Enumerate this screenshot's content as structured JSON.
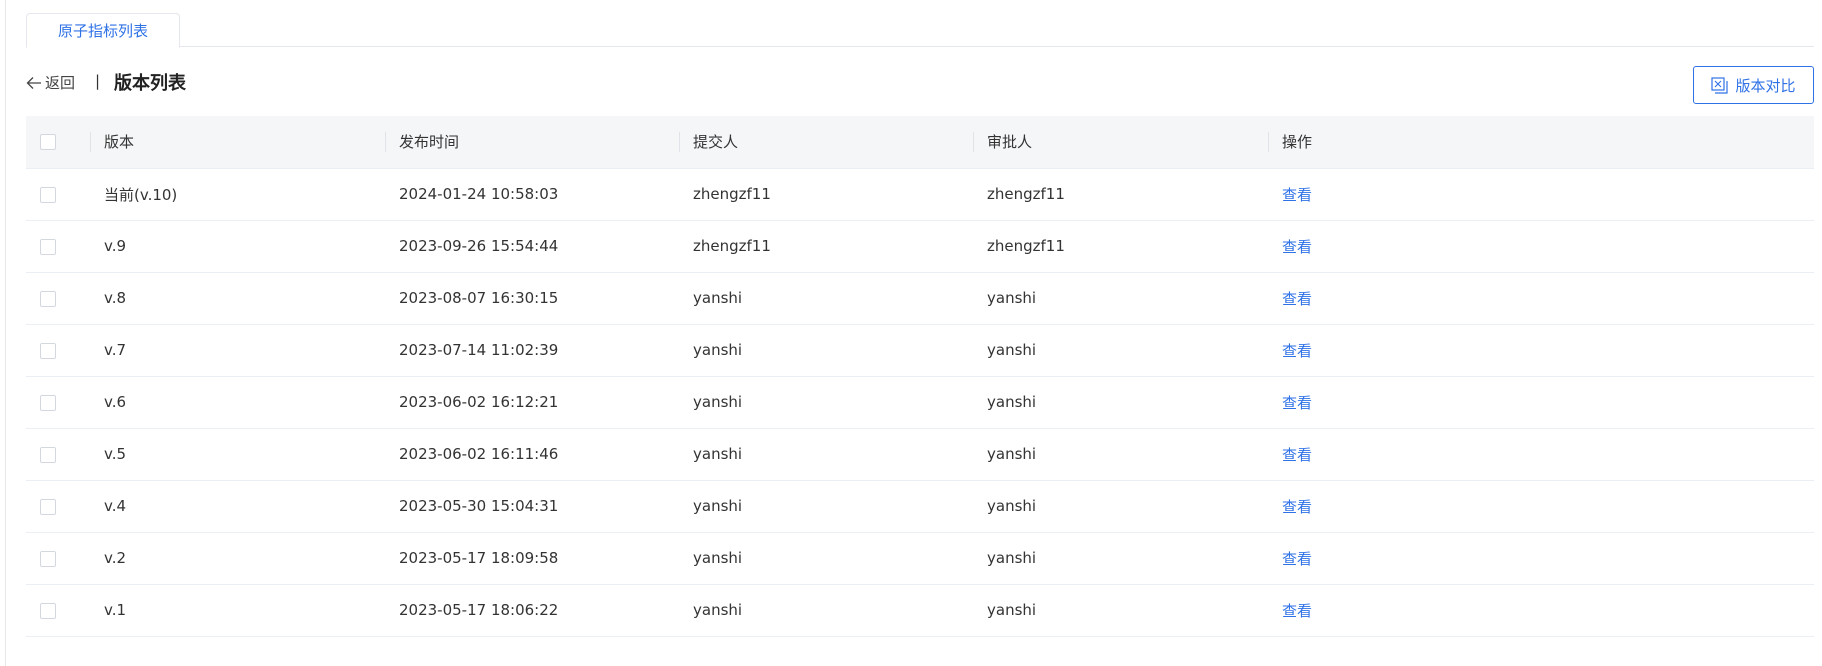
{
  "tabs": [
    {
      "label": "原子指标列表",
      "active": true
    }
  ],
  "header": {
    "back_label": "返回",
    "separator": "|",
    "title": "版本列表",
    "compare_button": "版本对比"
  },
  "table": {
    "columns": [
      "版本",
      "发布时间",
      "提交人",
      "审批人",
      "操作"
    ],
    "rows": [
      {
        "version": "当前(v.10)",
        "time": "2024-01-24 10:58:03",
        "submitter": "zhengzf11",
        "approver": "zhengzf11",
        "action": "查看"
      },
      {
        "version": "v.9",
        "time": "2023-09-26 15:54:44",
        "submitter": "zhengzf11",
        "approver": "zhengzf11",
        "action": "查看"
      },
      {
        "version": "v.8",
        "time": "2023-08-07 16:30:15",
        "submitter": "yanshi",
        "approver": "yanshi",
        "action": "查看"
      },
      {
        "version": "v.7",
        "time": "2023-07-14 11:02:39",
        "submitter": "yanshi",
        "approver": "yanshi",
        "action": "查看"
      },
      {
        "version": "v.6",
        "time": "2023-06-02 16:12:21",
        "submitter": "yanshi",
        "approver": "yanshi",
        "action": "查看"
      },
      {
        "version": "v.5",
        "time": "2023-06-02 16:11:46",
        "submitter": "yanshi",
        "approver": "yanshi",
        "action": "查看"
      },
      {
        "version": "v.4",
        "time": "2023-05-30 15:04:31",
        "submitter": "yanshi",
        "approver": "yanshi",
        "action": "查看"
      },
      {
        "version": "v.2",
        "time": "2023-05-17 18:09:58",
        "submitter": "yanshi",
        "approver": "yanshi",
        "action": "查看"
      },
      {
        "version": "v.1",
        "time": "2023-05-17 18:06:22",
        "submitter": "yanshi",
        "approver": "yanshi",
        "action": "查看"
      }
    ]
  },
  "icons": {
    "back": "arrow-left-icon",
    "compare": "compare-icon"
  },
  "colors": {
    "accent": "#2f72e6",
    "header_bg": "#f5f6f8",
    "border": "#ebeef5"
  }
}
